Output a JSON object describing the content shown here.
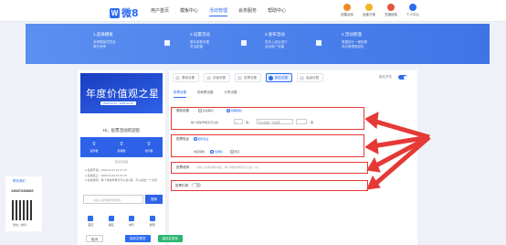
{
  "logo": {
    "mark": "W",
    "text": "微8"
  },
  "nav": [
    "用户首页",
    "模板中心",
    "活动管理",
    "会务服务",
    "帮助中心"
  ],
  "nav_active_index": 2,
  "top_icons": [
    {
      "label": "创建活动",
      "color": "#f08a24",
      "icon": "create-icon"
    },
    {
      "label": "运营方案",
      "color": "#f0b323",
      "icon": "plan-icon"
    },
    {
      "label": "充值续费",
      "color": "#e5533d",
      "icon": "recharge-icon"
    },
    {
      "label": "个人中心",
      "color": "#2d6cf0",
      "icon": "user-icon"
    }
  ],
  "banner_steps": [
    {
      "title": "1.选择模板",
      "desc": "多种模板任意选\n提升效率"
    },
    {
      "title": "2.设置活动",
      "desc": "基本参数设置\n灵活配置"
    },
    {
      "title": "3.发布活动",
      "desc": "发布上线后进行\n活动推广传播"
    },
    {
      "title": "4.活动管理",
      "desc": "数据统计一键查看\n选手管理更轻松"
    }
  ],
  "preview": {
    "poster_title": "年度价值观之星",
    "poster_sub": "2020.04.22 - 2020.04.30",
    "head": "Hi，投票活动欢迎您",
    "stats": [
      {
        "num": "0",
        "label": "选手数"
      },
      {
        "num": "0",
        "label": "投票数"
      },
      {
        "num": "0",
        "label": "访问量"
      }
    ],
    "countdown": "活动已结束",
    "info": [
      "● 投票开始：2020-04-22 10:37:18",
      "● 投票截止：2020-04-30 10:37:18",
      "● 投票规则：每个微信号每天可以投1票，可以投给一个选手"
    ],
    "search_placeholder": "请输入选手编号或名称",
    "search_btn": "搜索",
    "tabs": [
      "首页",
      "报名",
      "排行",
      "规则"
    ]
  },
  "steps_row": [
    "基础设置",
    "页面设置",
    "投票设置",
    "报名设置",
    "高级设置"
  ],
  "steps_active_index": 3,
  "switch_label": "报名开关",
  "subtabs": [
    "投票设置",
    "防刷票设置",
    "分享设置"
  ],
  "subtab_active_index": 0,
  "form": {
    "limit_label": "限制设置",
    "limit_opt1": "活动期间",
    "limit_opt2": "周期限制",
    "limit_line": "每个微信号每天可以投",
    "limit_value": "1",
    "limit_unit": "票，",
    "limit_select": "可以投给一位选手",
    "limit_tail": "票",
    "captcha_label": "投票验证",
    "captcha_opt": "图形验证",
    "location_label": "地区限制",
    "location_opt1": "无限制",
    "location_opt2": "限定",
    "location_hint": "请输入",
    "remark_label": "投票说明",
    "remark_placeholder": "请输入投票说明(例如：每个微信号每天可以投一次)",
    "gift_label": "投票礼物"
  },
  "bottom_buttons": [
    "取消",
    "保存并预览",
    "保存并发布"
  ],
  "side": {
    "title": "联系我们",
    "phone": "13697336669",
    "qr_label": "微信二维码"
  }
}
